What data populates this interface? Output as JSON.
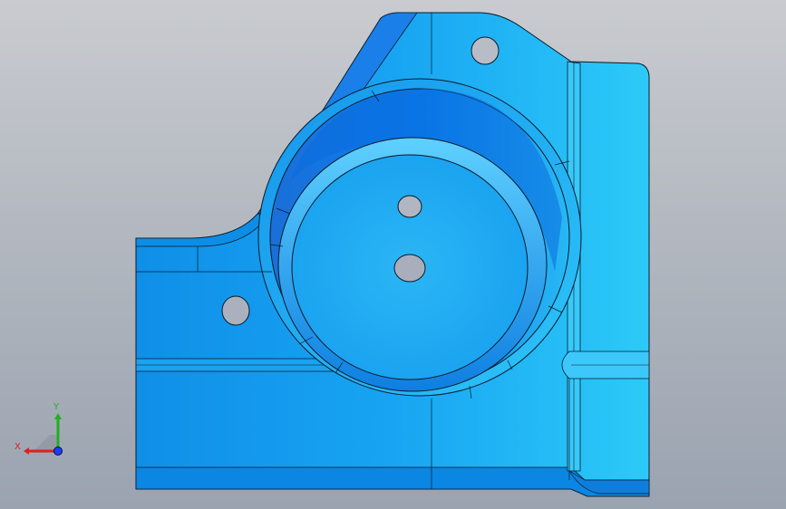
{
  "viewport": {
    "background_top": "#c9cbd0",
    "background_bottom": "#9aa3b0"
  },
  "model": {
    "part_color": "#1ea8f0",
    "edge_color": "#0a1a2a",
    "features": [
      "base-plate",
      "cylindrical-boss",
      "mounting-hole",
      "mounting-hole",
      "center-hole",
      "center-hole",
      "fillet-edges"
    ]
  },
  "triad": {
    "x_label": "X",
    "y_label": "Y",
    "x_color": "#e02020",
    "y_color": "#20b020",
    "z_color": "#1a3cff"
  }
}
